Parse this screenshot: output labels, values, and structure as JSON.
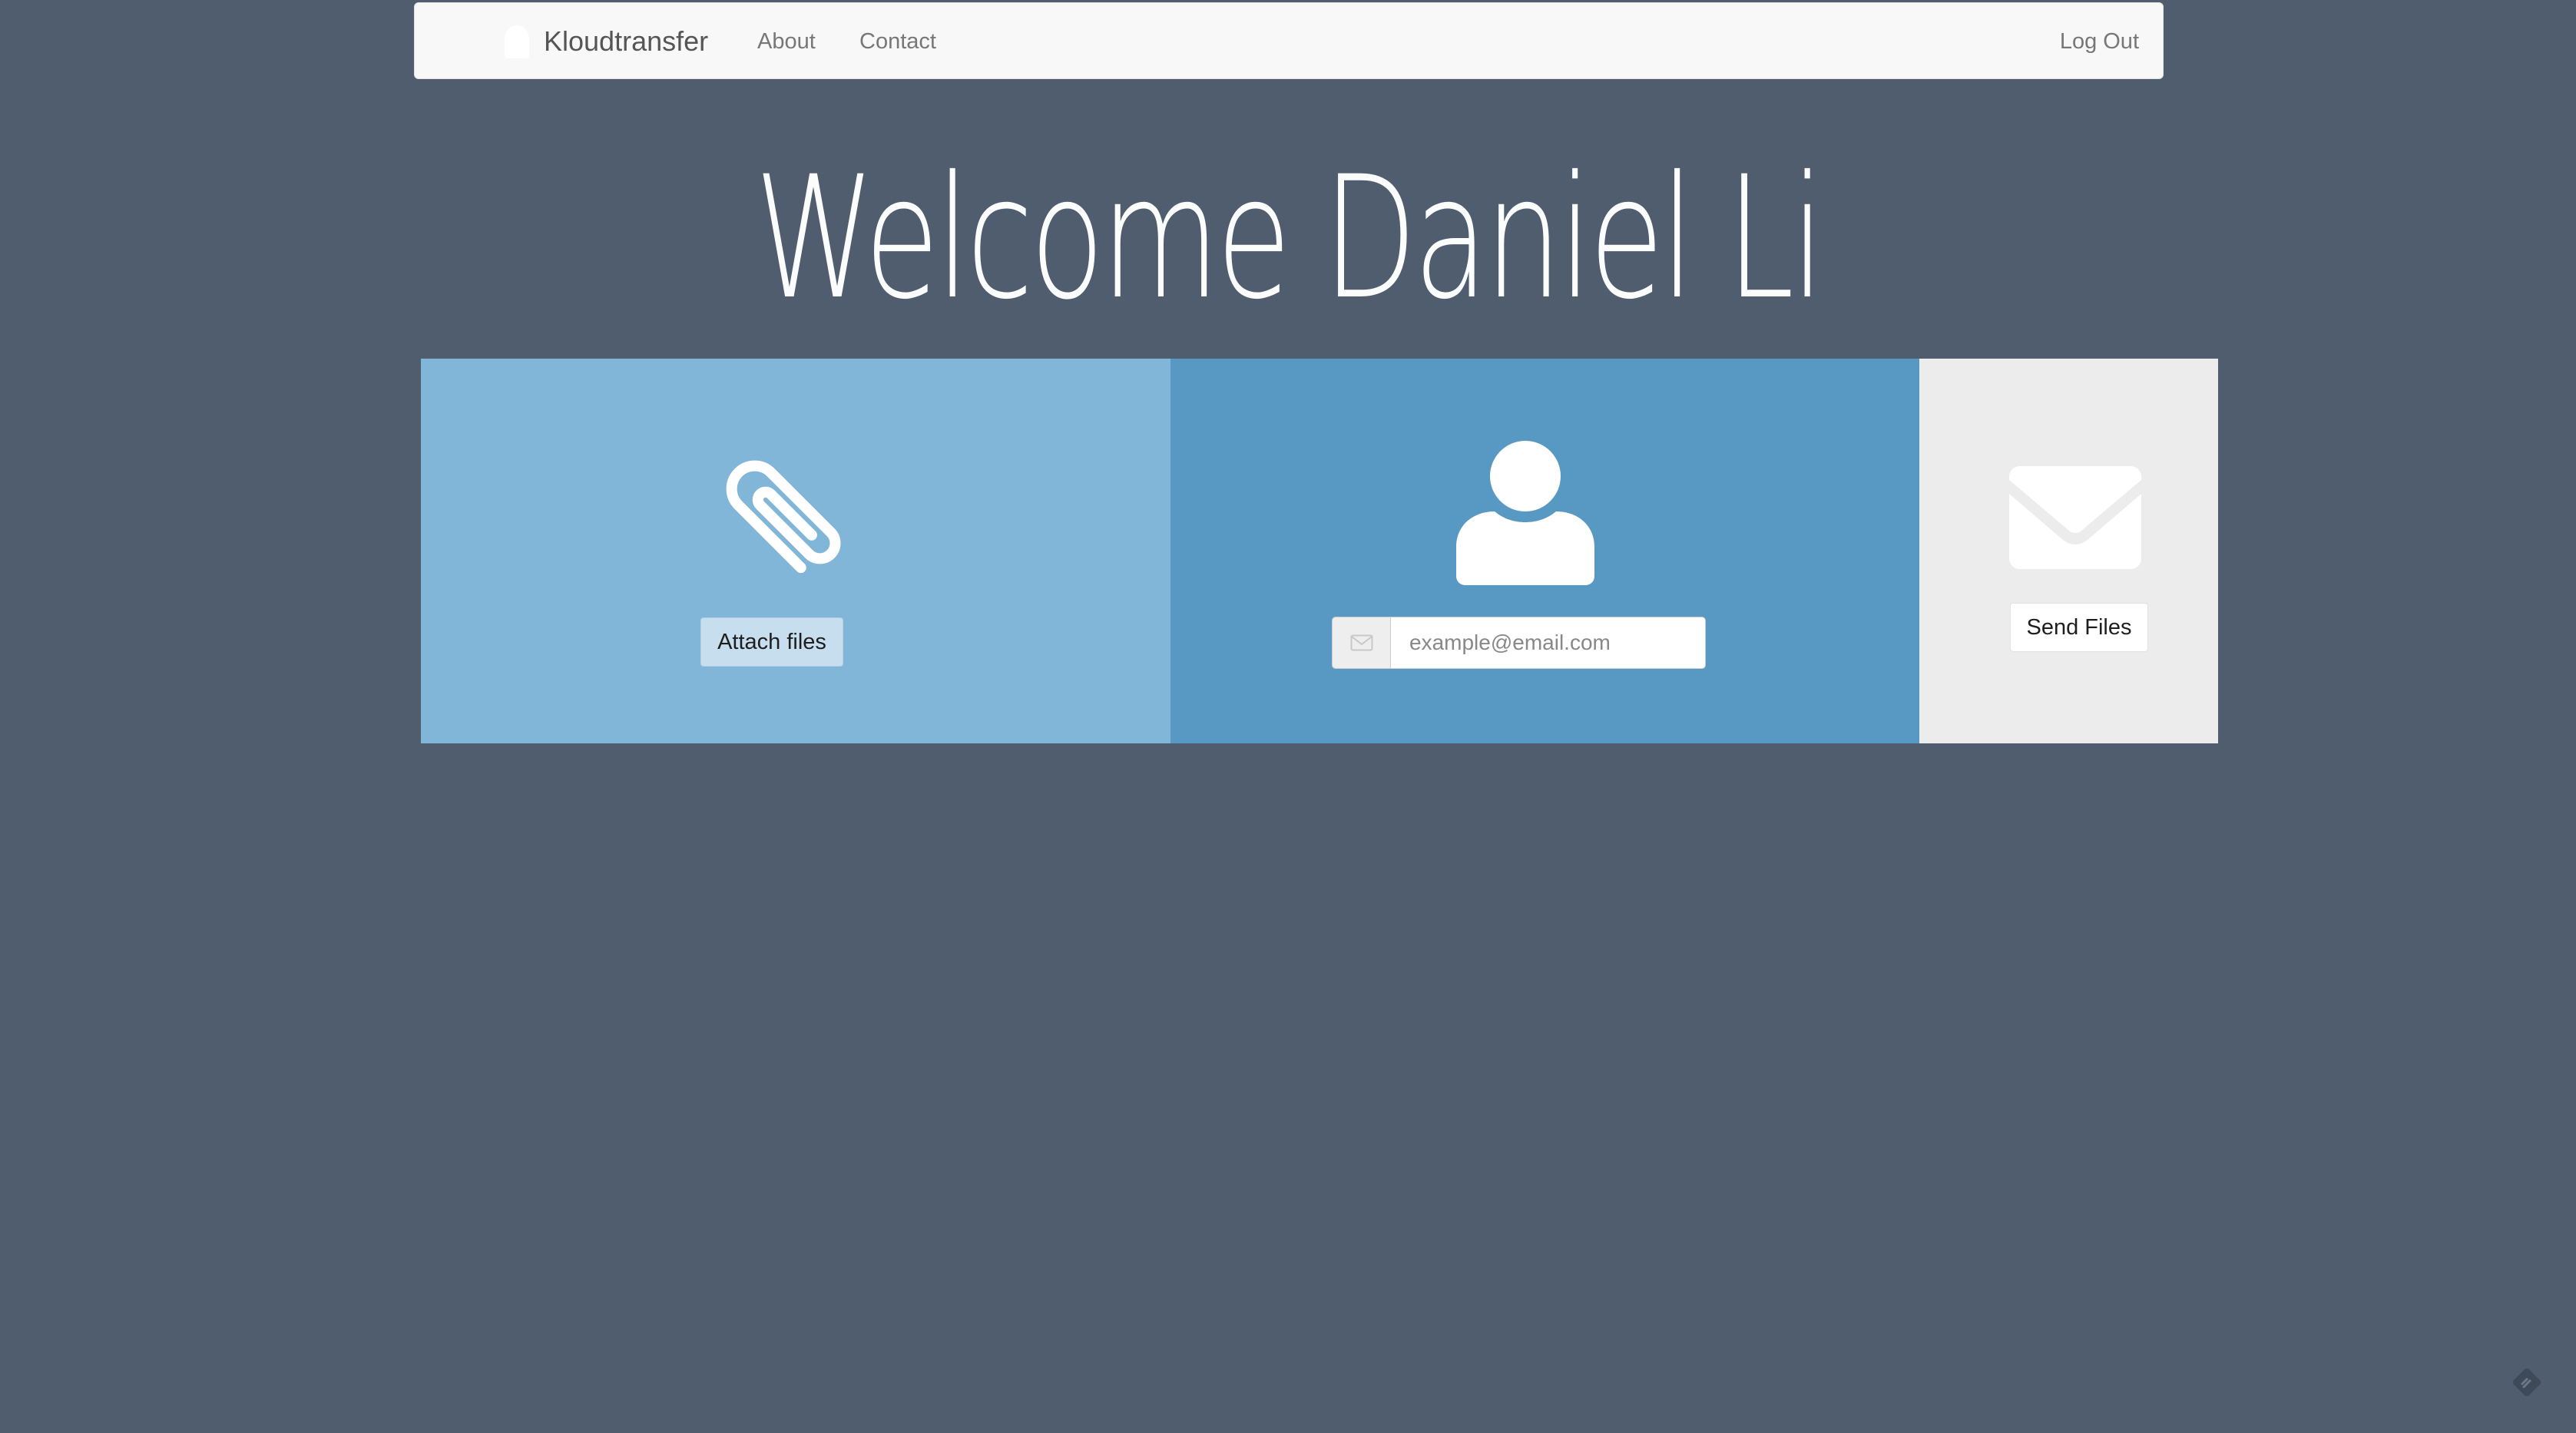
{
  "navbar": {
    "brand": "Kloudtransfer",
    "brand_icon": "cloud-logo",
    "links": {
      "about": "About",
      "contact": "Contact",
      "logout": "Log Out"
    }
  },
  "welcome": {
    "heading": "Welcome Daniel Li"
  },
  "attach_panel": {
    "icon": "paperclip-icon",
    "button_label": "Attach files",
    "color": "#82b6d8"
  },
  "recipient_panel": {
    "icon": "user-icon",
    "email_icon": "envelope-icon",
    "email_value": "",
    "email_placeholder": "example@email.com",
    "color": "#5899c4"
  },
  "send_panel": {
    "icon": "envelope-icon",
    "button_label": "Send Files",
    "color": "#ececec"
  },
  "colors": {
    "background": "#505d6f",
    "navbar": "#f8f8f8"
  }
}
